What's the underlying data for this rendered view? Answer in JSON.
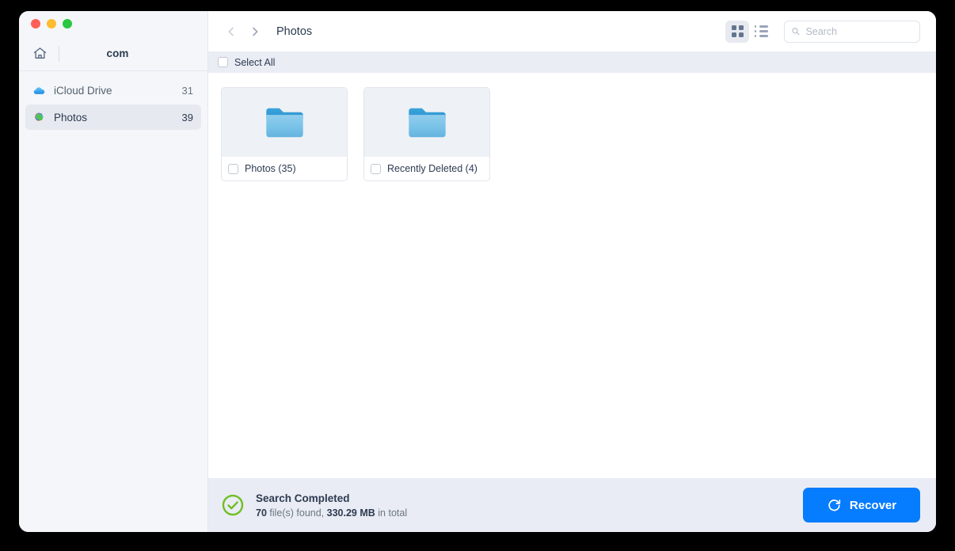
{
  "window": {
    "traffic_lights": [
      {
        "name": "close",
        "color": "#ff5f57"
      },
      {
        "name": "minimize",
        "color": "#febc2e"
      },
      {
        "name": "zoom",
        "color": "#28c840"
      }
    ]
  },
  "sidebar": {
    "home_icon": "home-icon",
    "breadcrumb": "com",
    "items": [
      {
        "label": "iCloud Drive",
        "count": "31",
        "icon": "icloud-drive-icon",
        "active": false
      },
      {
        "label": "Photos",
        "count": "39",
        "icon": "photos-app-icon",
        "active": true
      }
    ]
  },
  "toolbar": {
    "back_icon": "chevron-left-icon",
    "forward_icon": "chevron-right-icon",
    "title": "Photos",
    "grid_view_icon": "grid-view-icon",
    "list_view_icon": "list-view-icon",
    "active_view": "grid",
    "search": {
      "icon": "search-icon",
      "value": "",
      "placeholder": "Search"
    }
  },
  "select_all": {
    "label": "Select All",
    "checked": false
  },
  "content": {
    "items": [
      {
        "name": "Photos (35)",
        "icon": "folder-icon",
        "checked": false
      },
      {
        "name": "Recently Deleted (4)",
        "icon": "folder-icon",
        "checked": false
      }
    ]
  },
  "statusbar": {
    "status_icon": "check-circle-icon",
    "title": "Search Completed",
    "count": "70",
    "found_text": " file(s) found, ",
    "size": "330.29 MB",
    "total_text": " in total",
    "recover_icon": "refresh-icon",
    "recover_label": "Recover",
    "accent_color": "#067cff",
    "success_color": "#6fbe22"
  }
}
